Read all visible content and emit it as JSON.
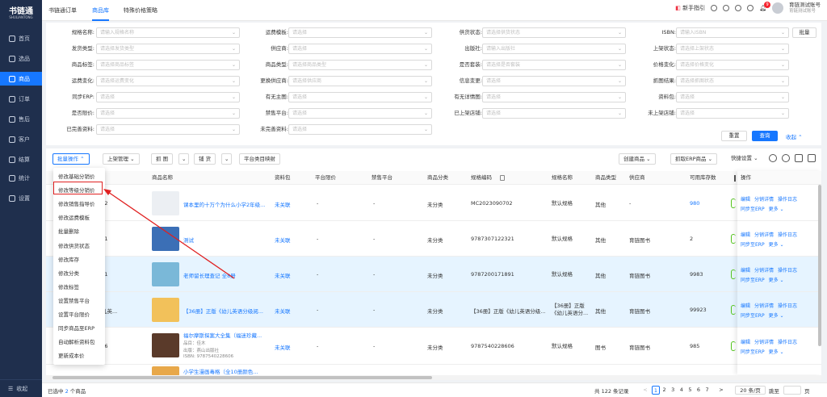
{
  "logo": {
    "name": "书链通",
    "sub": "SHULIANTONG"
  },
  "sidebar": {
    "items": [
      {
        "label": "首页",
        "icon": "monitor-icon"
      },
      {
        "label": "选品",
        "icon": "select-icon"
      },
      {
        "label": "商品",
        "icon": "goods-icon",
        "active": true
      },
      {
        "label": "订单",
        "icon": "order-icon"
      },
      {
        "label": "售后",
        "icon": "aftersale-icon"
      },
      {
        "label": "客户",
        "icon": "customer-icon"
      },
      {
        "label": "结算",
        "icon": "settlement-icon"
      },
      {
        "label": "统计",
        "icon": "stats-icon"
      },
      {
        "label": "设置",
        "icon": "settings-icon"
      }
    ],
    "collapse": "收起"
  },
  "topbar": {
    "tabs": [
      "书链通订单",
      "商品库",
      "特殊价格策略"
    ],
    "active_tab": 1,
    "guide": "新手指引",
    "badge": "9",
    "account_name": "育链测试账号",
    "account_sub": "育链测试账号"
  },
  "filters": {
    "rows": [
      [
        {
          "label": "规格名称:",
          "ph": "请输入规格名称"
        },
        {
          "label": "运费模板:",
          "ph": "请选择"
        },
        {
          "label": "供货状态:",
          "ph": "请选择供货状态"
        },
        {
          "label": "ISBN:",
          "ph": "请输入ISBN"
        }
      ],
      [
        {
          "label": "发货类型:",
          "ph": "请选择发货类型"
        },
        {
          "label": "供应商:",
          "ph": "请选择"
        },
        {
          "label": "出版社:",
          "ph": "请输入出版社"
        },
        {
          "label": "上架状态:",
          "ph": "请选择上架状态"
        }
      ],
      [
        {
          "label": "商品标签:",
          "ph": "请选择商品标签"
        },
        {
          "label": "商品类型:",
          "ph": "请选择商品类型"
        },
        {
          "label": "是否套装:",
          "ph": "请选择是否套装"
        },
        {
          "label": "价格变化:",
          "ph": "请选择价格变化"
        }
      ],
      [
        {
          "label": "运费变化:",
          "ph": "请选择运费变化"
        },
        {
          "label": "更换供应商:",
          "ph": "请选择供应商"
        },
        {
          "label": "信息变更:",
          "ph": "请选择"
        },
        {
          "label": "抓图结果:",
          "ph": "请选择抓图状态"
        }
      ],
      [
        {
          "label": "同步ERP:",
          "ph": "请选择"
        },
        {
          "label": "有无主图:",
          "ph": "请选择"
        },
        {
          "label": "有无详情图:",
          "ph": "请选择"
        },
        {
          "label": "资料包:",
          "ph": "请选择"
        }
      ],
      [
        {
          "label": "是否限价:",
          "ph": "请选择"
        },
        {
          "label": "禁售平台:",
          "ph": "请选择"
        },
        {
          "label": "已上架店铺:",
          "ph": "请选择"
        },
        {
          "label": "未上架店铺:",
          "ph": "请选择"
        }
      ],
      [
        {
          "label": "已完善资料:",
          "ph": "请选择"
        },
        {
          "label": "未完善资料:",
          "ph": "请选择"
        }
      ]
    ],
    "batch": "批量",
    "reset": "重置",
    "query": "查询",
    "collapse": "收起"
  },
  "toolbar": {
    "batch_op": "批量操作",
    "shelf": "上架管理",
    "grab": "抓 图",
    "sync": "铺 货",
    "category": "平台类目映射",
    "create": "创建商品",
    "grab_erp": "抓取ERP商品",
    "quick_set": "快捷设置"
  },
  "columns": [
    "商品名称",
    "资料包",
    "平台限价",
    "禁售平台",
    "商品分类",
    "规格编码",
    "规格名称",
    "商品类型",
    "供应商",
    "可用库存数",
    "操作"
  ],
  "rows": [
    {
      "code_suffix": "0702",
      "name": "课本里的十万个为什么小学2年级...",
      "meta": [],
      "pack": "未关联",
      "limit": "-",
      "ban": "-",
      "cat": "未分类",
      "sku": "MC2023090702",
      "spec": "默认规格",
      "type": "其他",
      "supplier": "-",
      "stock": "980",
      "stock_link": true,
      "ops": [
        "编辑",
        "分销详情",
        "操作日志",
        "同步至ERP",
        "更多"
      ],
      "sel": false,
      "thumb": "#eceff3"
    },
    {
      "code_suffix": "2321",
      "name": "测试",
      "meta": [],
      "pack": "未关联",
      "limit": "-",
      "ban": "-",
      "cat": "未分类",
      "sku": "9787307122321",
      "spec": "默认规格",
      "type": "其他",
      "supplier": "育链图书",
      "stock": "2",
      "stock_link": false,
      "ops": [
        "编辑",
        "分销详情",
        "操作日志",
        "同步至ERP",
        "更多"
      ],
      "sel": false,
      "thumb": "#3b6fb6"
    },
    {
      "code_suffix": "1891",
      "name": "老师留长理查记 全8册",
      "meta": [],
      "pack": "未关联",
      "limit": "-",
      "ban": "-",
      "cat": "未分类",
      "sku": "9787200171891",
      "spec": "默认规格",
      "type": "其他",
      "supplier": "育链图书",
      "stock": "9983",
      "stock_link": false,
      "ops": [
        "编辑",
        "分销详情",
        "操作日志",
        "同步至ERP",
        "更多"
      ],
      "sel": true,
      "thumb": "#7ab8d8"
    },
    {
      "code_suffix": "(幼儿英...",
      "name": "【36册】正版《幼儿英语分级阅...",
      "meta": [],
      "pack": "未关联",
      "limit": "-",
      "ban": "-",
      "cat": "未分类",
      "sku": "【36册】正版《幼儿英语分级...",
      "spec": "【36册】正版\n《幼儿英语分...",
      "type": "其他",
      "supplier": "育链图书",
      "stock": "99923",
      "stock_link": false,
      "ops": [
        "编辑",
        "分销详情",
        "操作日志",
        "同步至ERP",
        "更多"
      ],
      "sel": true,
      "thumb": "#f2c15a"
    },
    {
      "code_suffix": "8606",
      "name": "福尔摩斯探案大全集（福迷珍藏...",
      "meta": [
        "品目：佳木",
        "出版：燕山出版社",
        "ISBN: 9787540228606"
      ],
      "pack": "未关联",
      "limit": "-",
      "ban": "-",
      "cat": "未分类",
      "sku": "9787540228606",
      "spec": "默认规格",
      "type": "图书",
      "supplier": "育链图书",
      "stock": "985",
      "stock_link": false,
      "ops": [
        "编辑",
        "分销详情",
        "操作日志",
        "同步至ERP",
        "更多"
      ],
      "sel": false,
      "thumb": "#5a3a2a"
    },
    {
      "code_suffix": "",
      "name": "小学生漫画毒格（全10册颜色...",
      "meta": [],
      "pack": "",
      "limit": "",
      "ban": "",
      "cat": "",
      "sku": "",
      "spec": "",
      "type": "",
      "supplier": "",
      "stock": "",
      "stock_link": false,
      "ops": [],
      "sel": false,
      "thumb": "#e8a84a"
    }
  ],
  "menu": [
    "修改基础分销价",
    "修改等级分销价",
    "修改销售指导价",
    "修改运费模板",
    "批量删除",
    "修改供货状态",
    "修改库存",
    "修改分类",
    "修改标签",
    "设置禁售平台",
    "设置平台限价",
    "同步商品至ERP",
    "自动解析资料包",
    "更新成本价"
  ],
  "footer": {
    "selected_pre": "已选中",
    "selected_count": "2",
    "selected_post": "个商品",
    "total": "共 122 条记录",
    "pages": [
      "1",
      "2",
      "3",
      "4",
      "5",
      "6",
      "7"
    ],
    "next": ">",
    "page_size": "20 条/页",
    "goto": "跳至",
    "page_suffix": "页"
  }
}
